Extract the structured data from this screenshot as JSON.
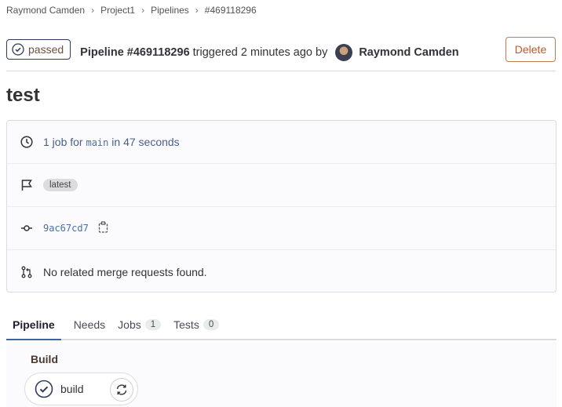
{
  "breadcrumbs": [
    "Raymond Camden",
    "Project1",
    "Pipelines",
    "#469118296"
  ],
  "header": {
    "status": "passed",
    "pipeline_label": "Pipeline #469118296",
    "triggered_text": "triggered 2 minutes ago by",
    "user": "Raymond Camden",
    "delete_label": "Delete"
  },
  "title": "test",
  "info": {
    "job_count": "1 job for",
    "branch": "main",
    "duration": "in 47 seconds",
    "tag": "latest",
    "commit": "9ac67cd7",
    "merge_requests": "No related merge requests found."
  },
  "tabs": [
    {
      "label": "Pipeline"
    },
    {
      "label": "Needs"
    },
    {
      "label": "Jobs",
      "count": "1"
    },
    {
      "label": "Tests",
      "count": "0"
    }
  ],
  "stage": {
    "title": "Build",
    "job": "build"
  }
}
